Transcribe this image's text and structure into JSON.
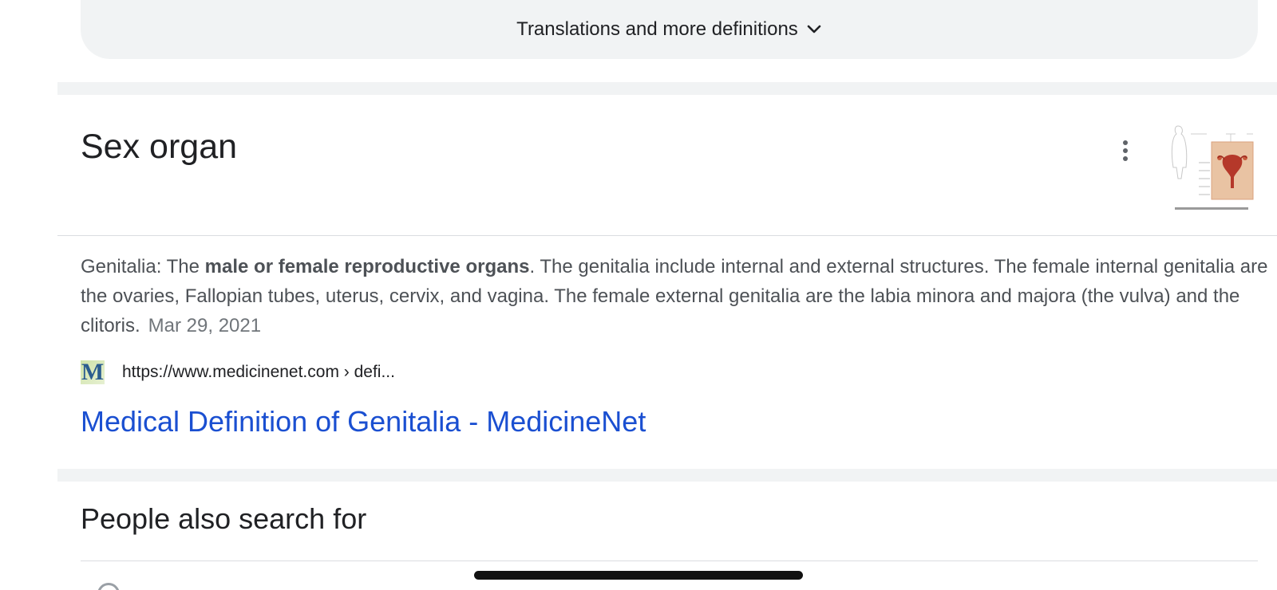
{
  "translations_button": {
    "label": "Translations and more definitions"
  },
  "card": {
    "title": "Sex organ",
    "snippet": {
      "prefix": "Genitalia: The ",
      "bold": "male or female reproductive organs",
      "rest": ". The genitalia include internal and external structures. The female internal genitalia are the ovaries, Fallopian tubes, uterus, cervix, and vagina. The female external genitalia are the labia minora and majora (the vulva) and the clitoris.",
      "date": "Mar 29, 2021"
    },
    "source": {
      "favicon_letter": "M",
      "url": "https://www.medicinenet.com › defi..."
    },
    "result_title": "Medical Definition of Genitalia - MedicineNet"
  },
  "people_also_search": {
    "title": "People also search for"
  },
  "colors": {
    "link": "#1a4fd1",
    "separator": "#f1f3f4",
    "snippet_text": "#4d5156"
  }
}
